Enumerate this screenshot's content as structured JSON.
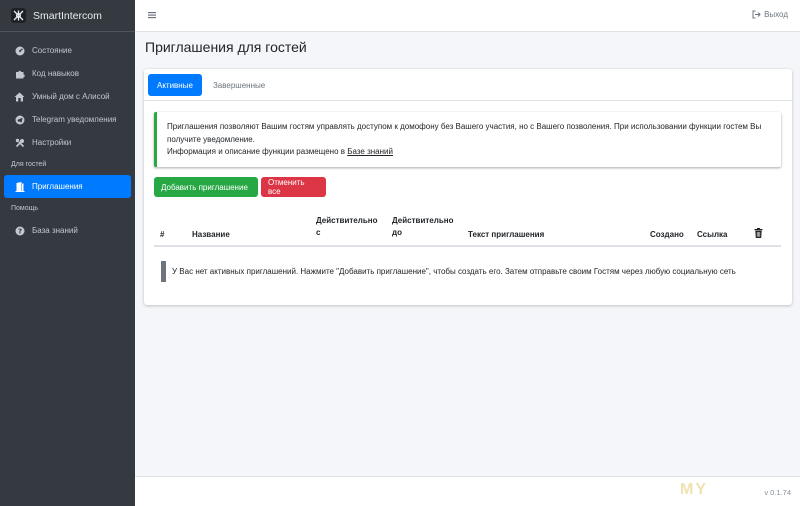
{
  "app": {
    "brand": "SmartIntercom",
    "version": "v 0.1.74",
    "watermark": "MY",
    "accent": "#007bff"
  },
  "sidebar": {
    "items": [
      {
        "label": "Состояние",
        "icon": "dashboard-icon"
      },
      {
        "label": "Код навыков",
        "icon": "puzzle-icon"
      },
      {
        "label": "Умный дом с Алисой",
        "icon": "home-icon"
      },
      {
        "label": "Telegram уведомления",
        "icon": "telegram-icon"
      },
      {
        "label": "Настройки",
        "icon": "tools-icon"
      }
    ],
    "section_guests": "Для гостей",
    "invites_item": {
      "label": "Приглашения",
      "icon": "door-icon",
      "active": true
    },
    "section_help": "Помощь",
    "knowledge_item": {
      "label": "База знаний",
      "icon": "question-icon"
    }
  },
  "topbar": {
    "logout_label": "Выход"
  },
  "page": {
    "title": "Приглашения для гостей",
    "tabs": [
      {
        "label": "Активные",
        "active": true
      },
      {
        "label": "Завершенные",
        "active": false
      }
    ],
    "callout": {
      "text_line1": "Приглашения позволяют Вашим гостям управлять доступом к домофону без Вашего участия, но с Вашего позволения. При использовании функции гостем Вы получите уведомление.",
      "text_line2_prefix": "Информация и описание функции размещено в ",
      "text_line2_link": "Базе знаний"
    },
    "buttons": {
      "add": "Добавить приглашение",
      "cancel_all": "Отменить все"
    },
    "table": {
      "headers": {
        "num": "#",
        "name": "Название",
        "valid_from": "Действительно с",
        "valid_to": "Действительно до",
        "text": "Текст приглашения",
        "created": "Создано",
        "link": "Ссылка",
        "delete": "trash-icon"
      },
      "empty_message": "У Вас нет активных приглашений. Нажмите \"Добавить приглашение\", чтобы создать его. Затем отправьте своим Гостям через любую социальную сеть"
    }
  }
}
